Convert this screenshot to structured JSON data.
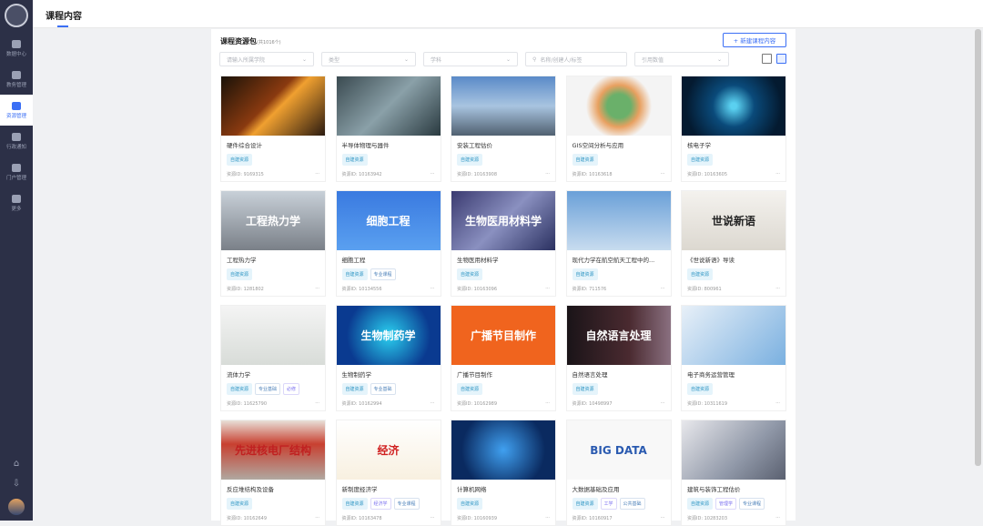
{
  "sidebar": {
    "items": [
      {
        "label": "数据中心",
        "icon": "chart-icon"
      },
      {
        "label": "教务管理",
        "icon": "layers-icon"
      },
      {
        "label": "资源管理",
        "icon": "basket-icon",
        "active": true
      },
      {
        "label": "行政通知",
        "icon": "bell-icon"
      },
      {
        "label": "门户管理",
        "icon": "shirt-icon"
      },
      {
        "label": "更多",
        "icon": "grid-icon"
      }
    ]
  },
  "header": {
    "title": "课程内容"
  },
  "panel": {
    "title": "课程资源包",
    "count": "(共1016个)",
    "new_button": "+ 新建课程内容",
    "filters": {
      "college": "请输入所属学院",
      "type": "类型",
      "subject": "学科",
      "search": "名称/创建人/标签",
      "reference": "引用数值"
    }
  },
  "cards": [
    {
      "name": "硬件综合设计",
      "tags": [
        "自建资源"
      ],
      "id": "资源ID: 9169315",
      "bg": "linear-gradient(135deg,#1a1208,#8a3a10 45%,#f0a030 55%,#2a1a10)"
    },
    {
      "name": "半导体物理与器件",
      "tags": [
        "自建资源"
      ],
      "id": "资源ID: 10163942",
      "bg": "linear-gradient(135deg,#3a4a50,#8aa0a8 50%,#2a3a40)"
    },
    {
      "name": "安装工程估价",
      "tags": [
        "自建资源"
      ],
      "id": "资源ID: 10163908",
      "bg": "linear-gradient(180deg,#5a8ac8,#a8c4e0 50%,#506070)"
    },
    {
      "name": "GIS空间分析与应用",
      "tags": [
        "自建资源"
      ],
      "id": "资源ID: 10163618",
      "bg": "radial-gradient(circle,#6ab06a 20%,#e8a060 35%,#f4f4f4 55%)"
    },
    {
      "name": "核电子学",
      "tags": [
        "自建资源"
      ],
      "id": "资源ID: 10163605",
      "bg": "radial-gradient(circle,#5ad0f0 5%,#0a4a7a 35%,#041a30 80%)"
    },
    {
      "name": "工程热力学",
      "tags": [
        "自建资源"
      ],
      "id": "资源ID: 1281802",
      "bg": "linear-gradient(180deg,#c8d0d8,#7a8088)",
      "text": "工程热力学",
      "tc": "#fff"
    },
    {
      "name": "细胞工程",
      "tags": [
        "自建资源",
        "专业课程"
      ],
      "id": "资源ID: 10134556",
      "bg": "linear-gradient(180deg,#3a7ae0,#5aa0f0)",
      "text": "细胞工程",
      "tc": "#fff"
    },
    {
      "name": "生物医用材料学",
      "tags": [
        "自建资源"
      ],
      "id": "资源ID: 10163096",
      "bg": "linear-gradient(135deg,#3a3a70,#8a90c0 50%,#2a3060)",
      "text": "生物医用材料学",
      "tc": "#fff"
    },
    {
      "name": "现代力学在航空航天工程中的...",
      "tags": [
        "自建资源"
      ],
      "id": "资源ID: 711576",
      "bg": "linear-gradient(180deg,#6aa0d8,#c8dcef)"
    },
    {
      "name": "《世说新语》导读",
      "tags": [
        "自建资源"
      ],
      "id": "资源ID: 800961",
      "bg": "linear-gradient(180deg,#f4f2ee,#dcd8d0)",
      "text": "世说新语",
      "tc": "#222"
    },
    {
      "name": "流体力学",
      "tags": [
        "自建资源",
        "专业基础",
        "必修"
      ],
      "id": "资源ID: 11625790",
      "bg": "linear-gradient(180deg,#f4f4f4,#d8dcd8)"
    },
    {
      "name": "生物制药学",
      "tags": [
        "自建资源",
        "专业基础"
      ],
      "id": "资源ID: 10162994",
      "bg": "radial-gradient(circle,#2ad0f0,#0a3a90 70%)",
      "text": "生物制药学",
      "tc": "#fff"
    },
    {
      "name": "广播节目制作",
      "tags": [
        "自建资源"
      ],
      "id": "资源ID: 10162989",
      "bg": "#f0641e",
      "text": "广播节目制作",
      "tc": "#fff"
    },
    {
      "name": "自然语言处理",
      "tags": [
        "自建资源"
      ],
      "id": "资源ID: 10498997",
      "bg": "linear-gradient(90deg,#1a1418,#4a2a30 60%,#8a7080)",
      "text": "自然语言处理",
      "tc": "#fff"
    },
    {
      "name": "电子商务运营管理",
      "tags": [
        "自建资源"
      ],
      "id": "资源ID: 10311619",
      "bg": "linear-gradient(135deg,#e8f0f8,#7ab0e0)"
    },
    {
      "name": "反应堆结构及设备",
      "tags": [
        "自建资源"
      ],
      "id": "资源ID: 10162649",
      "bg": "linear-gradient(180deg,#e8e0d8,#c84030 40%,#b0a8a0)",
      "text": "先进核电厂结构",
      "tc": "#c02020"
    },
    {
      "name": "新制度经济学",
      "tags": [
        "自建资源",
        "经济学",
        "专业课程"
      ],
      "id": "资源ID: 10163478",
      "bg": "linear-gradient(180deg,#fff,#f8f0e0)",
      "text": "经济",
      "tc": "#d02020"
    },
    {
      "name": "计算机网络",
      "tags": [
        "自建资源"
      ],
      "id": "资源ID: 10160939",
      "bg": "radial-gradient(circle,#40a0f0,#0a2a60 70%)"
    },
    {
      "name": "大数据基础及应用",
      "tags": [
        "自建资源",
        "工学",
        "公共基础"
      ],
      "id": "资源ID: 10160917",
      "bg": "#f8f8f8",
      "text": "BIG DATA",
      "tc": "#2a5ab0"
    },
    {
      "name": "建筑与装饰工程估价",
      "tags": [
        "自建资源",
        "管理学",
        "专业课程"
      ],
      "id": "资源ID: 10283203",
      "bg": "linear-gradient(135deg,#e8e8ec,#9098a8 60%,#5a6070)"
    }
  ]
}
